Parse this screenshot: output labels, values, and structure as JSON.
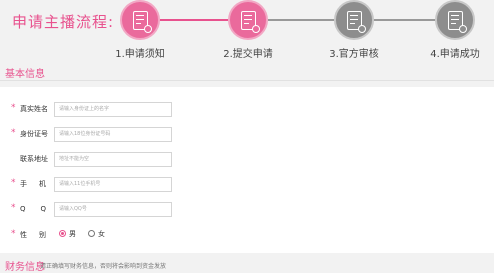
{
  "page": {
    "title": "申请主播流程:"
  },
  "steps": [
    {
      "label": "1.申请须知",
      "state": "active",
      "icon": "document-edit-icon"
    },
    {
      "label": "2.提交申请",
      "state": "active",
      "icon": "document-edit-icon"
    },
    {
      "label": "3.官方审核",
      "state": "inactive",
      "icon": "document-search-icon"
    },
    {
      "label": "4.申请成功",
      "state": "inactive",
      "icon": "document-check-icon"
    }
  ],
  "colors": {
    "accent": "#e8528e",
    "active_step": "#ea6a9c",
    "inactive_step": "#8d8d8d"
  },
  "basic_info": {
    "heading": "基本信息",
    "fields": [
      {
        "required": "*",
        "label": "真实姓名",
        "placeholder": "请输入身份证上的名字"
      },
      {
        "required": "*",
        "label": "身份证号",
        "placeholder": "请输入18位身份证号码"
      },
      {
        "required": "",
        "label": "联系地址",
        "placeholder": "地址不能为空"
      },
      {
        "required": "*",
        "label": "手　机",
        "placeholder": "请输入11位手机号"
      },
      {
        "required": "*",
        "label": "Q　Q",
        "placeholder": "请输入QQ号"
      }
    ],
    "gender": {
      "required": "*",
      "label": "性　别",
      "options": [
        "男",
        "女"
      ],
      "selected": "男"
    }
  },
  "finance_info": {
    "heading": "财务信息",
    "note": "请正确填写财务信息，否则将会影响到资金发放"
  }
}
